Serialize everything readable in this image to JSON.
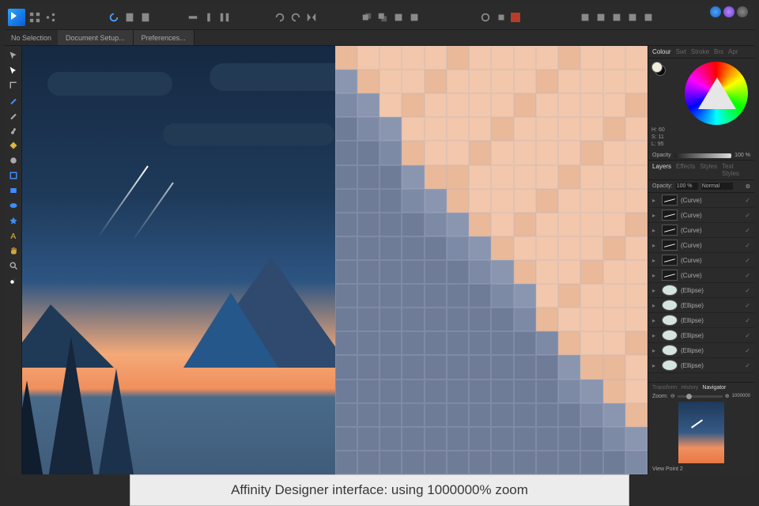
{
  "app_name": "Affinity Designer",
  "context_bar": {
    "selection": "No Selection",
    "tabs": [
      "Document Setup...",
      "Preferences..."
    ]
  },
  "personas": [
    "designer",
    "pixel",
    "export"
  ],
  "tools": [
    "move",
    "node",
    "corner",
    "pen",
    "pencil",
    "brush",
    "fill",
    "gradient",
    "transparency",
    "crop",
    "shape-rect",
    "shape-ellipse",
    "shape-star",
    "text-artistic",
    "text-frame",
    "pan",
    "zoom",
    "color-picker"
  ],
  "color_panel": {
    "tabs": [
      "Colour",
      "Swt",
      "Stroke",
      "Brs",
      "Apr"
    ],
    "active_tab": "Colour",
    "hsl": {
      "h": "H: 60",
      "s": "S: 11",
      "l": "L: 95"
    },
    "opacity_label": "Opacity",
    "opacity_value": "100 %"
  },
  "layers_panel": {
    "tabs": [
      "Layers",
      "Effects",
      "Styles",
      "Text Styles"
    ],
    "active": "Layers",
    "opacity_label": "Opacity:",
    "opacity": "100 %",
    "blend": "Normal",
    "items": [
      {
        "type": "curve",
        "name": "(Curve)"
      },
      {
        "type": "curve",
        "name": "(Curve)"
      },
      {
        "type": "curve",
        "name": "(Curve)"
      },
      {
        "type": "curve",
        "name": "(Curve)"
      },
      {
        "type": "curve",
        "name": "(Curve)"
      },
      {
        "type": "curve",
        "name": "(Curve)"
      },
      {
        "type": "ellipse",
        "name": "(Ellipse)"
      },
      {
        "type": "ellipse",
        "name": "(Ellipse)"
      },
      {
        "type": "ellipse",
        "name": "(Ellipse)"
      },
      {
        "type": "ellipse",
        "name": "(Ellipse)"
      },
      {
        "type": "ellipse",
        "name": "(Ellipse)"
      },
      {
        "type": "ellipse",
        "name": "(Ellipse)"
      }
    ]
  },
  "navigator": {
    "tabs": [
      "Transform",
      "History",
      "Navigator"
    ],
    "active": "Navigator",
    "zoom_label": "Zoom:",
    "zoom_value": "1000000",
    "viewpoint": "View Point 2"
  },
  "caption": "Affinity Designer interface: using 1000000% zoom",
  "pixel_colors": {
    "peach": "#f2c7ab",
    "peach2": "#e9b99a",
    "slate": "#7d8aa6",
    "slate2": "#8a96b0",
    "slate3": "#6f7c98"
  }
}
